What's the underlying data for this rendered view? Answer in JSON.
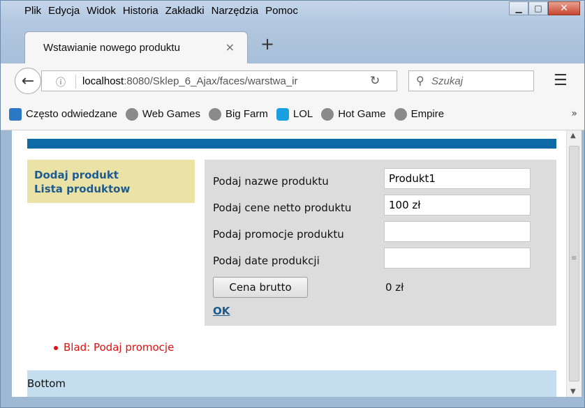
{
  "menu": [
    "Plik",
    "Edycja",
    "Widok",
    "Historia",
    "Zakładki",
    "Narzędzia",
    "Pomoc"
  ],
  "tab": {
    "title": "Wstawianie nowego produktu",
    "close": "×",
    "new_tab": "+"
  },
  "nav": {
    "url_host": "localhost",
    "url_rest": ":8080/Sklep_6_Ajax/faces/warstwa_ir",
    "search_placeholder": "Szukaj"
  },
  "bookmarks": [
    "Często odwiedzane",
    "Web Games",
    "Big Farm",
    "LOL",
    "Hot Game",
    "Empire"
  ],
  "sidebar": {
    "items": [
      "Dodaj produkt",
      "Lista produktow"
    ]
  },
  "form": {
    "name_label": "Podaj nazwe produktu",
    "name_value": "Produkt1",
    "price_label": "Podaj cene netto produktu",
    "price_value": "100 zł",
    "promo_label": "Podaj promocje produktu",
    "promo_value": "",
    "date_label": "Podaj date produkcji",
    "date_value": "",
    "brutto_button": "Cena brutto",
    "brutto_value": "0 zł",
    "ok_link": "OK"
  },
  "error": "Blad: Podaj promocje",
  "footer": "Bottom",
  "colors": {
    "topbar": "#0d6aa6",
    "menu_bg": "#ebe2a6",
    "link": "#1f5a8c",
    "error": "#e01010",
    "footer_bg": "#c4deef"
  }
}
